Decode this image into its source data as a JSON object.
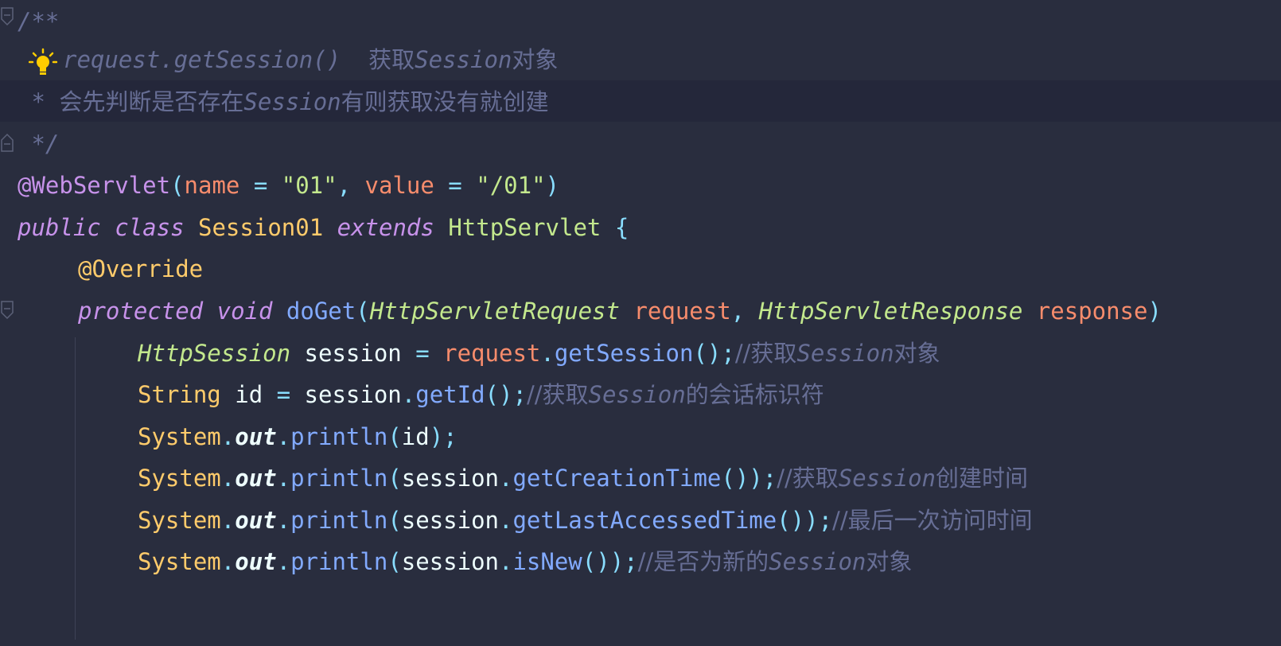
{
  "editor": {
    "doc_open": "/**",
    "doc_line1_code": "request.getSession()",
    "doc_line1_sp": "  ",
    "doc_line1_cjk_a": "获取",
    "doc_line1_it": "Session",
    "doc_line1_cjk_b": "对象",
    "doc_line2_star": " * ",
    "doc_line2_cjk_a": "会先判断是否存在",
    "doc_line2_it": "Session",
    "doc_line2_cjk_b": "有则获取没有就创建",
    "doc_close": " */",
    "annotation": {
      "at": "@WebServlet",
      "lparen": "(",
      "p1_name": "name",
      "eq1": " = ",
      "p1_val": "\"01\"",
      "comma": ", ",
      "p2_name": "value",
      "eq2": " = ",
      "p2_val": "\"/01\"",
      "rparen": ")"
    },
    "class_decl": {
      "kw_public": "public",
      "kw_class": "class",
      "name": "Session01",
      "kw_extends": "extends",
      "parent": "HttpServlet",
      "brace": "{"
    },
    "override": "@Override",
    "method_decl": {
      "kw_protected": "protected",
      "kw_void": "void",
      "name": "doGet",
      "lparen": "(",
      "t1": "HttpServletRequest",
      "p1": "request",
      "comma": ", ",
      "t2": "HttpServletResponse",
      "p2": "response",
      "rparen": ")"
    },
    "body": {
      "l1_type": "HttpSession",
      "l1_var": "session",
      "l1_eq": " = ",
      "l1_obj": "request",
      "l1_dot": ".",
      "l1_fn": "getSession",
      "l1_end": "();",
      "l1_cmt_a": "//获取",
      "l1_cmt_it": "Session",
      "l1_cmt_b": "对象",
      "l2_type": "String",
      "l2_var": "id",
      "l2_eq": " = ",
      "l2_obj": "session",
      "l2_dot": ".",
      "l2_fn": "getId",
      "l2_end": "();",
      "l2_cmt_a": "//获取",
      "l2_cmt_it": "Session",
      "l2_cmt_b": "的会话标识符",
      "sys": "System",
      "dot": ".",
      "out": "out",
      "println": "println",
      "l3_lp": "(",
      "l3_arg": "id",
      "l3_end": ");",
      "l4_lp": "(",
      "l4_obj": "session",
      "l4_fn": "getCreationTime",
      "l4_end": "());",
      "l4_cmt_a": "//获取",
      "l4_cmt_it": "Session",
      "l4_cmt_b": "创建时间",
      "l5_lp": "(",
      "l5_obj": "session",
      "l5_fn": "getLastAccessedTime",
      "l5_end": "());",
      "l5_cmt": "//最后一次访问时间",
      "l6_lp": "(",
      "l6_obj": "session",
      "l6_fn": "isNew",
      "l6_end": "());",
      "l6_cmt_a": "//是否为新的",
      "l6_cmt_it": "Session",
      "l6_cmt_b": "对象"
    }
  },
  "icons": {
    "bulb": "lightbulb-icon",
    "fold": "fold-marker-icon"
  },
  "colors": {
    "background": "#292d3e",
    "comment": "#676e95",
    "keyword": "#c792ea",
    "class": "#ffcb6b",
    "type": "#c3e88d",
    "string": "#c3e88d",
    "parameter": "#f78c6c",
    "punctuation": "#89ddff",
    "function": "#82aaff",
    "bulb": "#ffcc00"
  }
}
